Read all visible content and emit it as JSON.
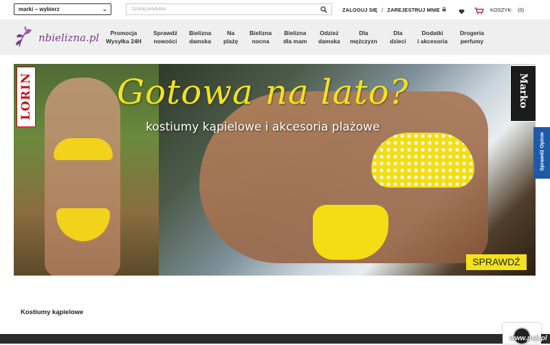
{
  "topbar": {
    "brand_select_value": "marki – wybierz",
    "search_placeholder": "Szukaj produktu",
    "login": "ZALOGUJ SIĘ",
    "separator": "/",
    "register": "ZAREJESTRUJ MNIE",
    "cart_label": "KOSZYK:",
    "cart_count": "(0)"
  },
  "logo": {
    "text": "nbielizna.pl"
  },
  "nav": {
    "items": [
      {
        "line1": "Promocja",
        "line2": "Wysyłka 24H"
      },
      {
        "line1": "Sprawdź",
        "line2": "nowości"
      },
      {
        "line1": "Bielizna",
        "line2": "damska"
      },
      {
        "line1": "Na",
        "line2": "plażę"
      },
      {
        "line1": "Bielizna",
        "line2": "nocna"
      },
      {
        "line1": "Bielizna",
        "line2": "dla mam"
      },
      {
        "line1": "Odzież",
        "line2": "damska"
      },
      {
        "line1": "Dla",
        "line2": "mężczyzn"
      },
      {
        "line1": "Dla",
        "line2": "dzieci"
      },
      {
        "line1": "Dodatki",
        "line2": "i akcesoria"
      },
      {
        "line1": "Drogeria",
        "line2": "perfumy"
      }
    ]
  },
  "hero": {
    "headline": "Gotowa na lato?",
    "subline": "kostiumy kąpielowe i akcesoria plażowe",
    "cta": "SPRAWDŹ",
    "brand_left": "LORIN",
    "brand_right": "Marko"
  },
  "side_tab": {
    "label": "Sprawdź Opinie"
  },
  "main": {
    "section_title": "Kostiumy kąpielowe"
  },
  "watermark": "www.psji.pl",
  "colors": {
    "accent": "#7a3a8a",
    "cta_yellow": "#f3e21c",
    "opinie_blue": "#1f5aa8",
    "cart_pink": "#c2185b"
  }
}
